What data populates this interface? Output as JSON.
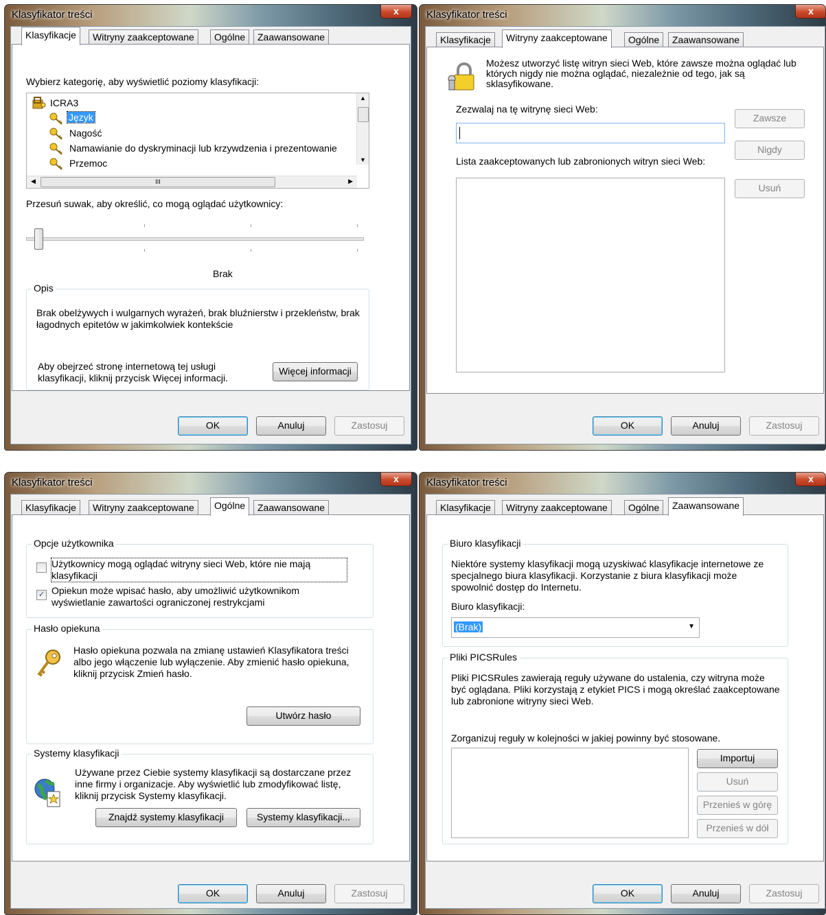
{
  "common": {
    "title": "Klasyfikator treści",
    "close": "x",
    "tabs": [
      "Klasyfikacje",
      "Witryny zaakceptowane",
      "Ogólne",
      "Zaawansowane"
    ],
    "ok": "OK",
    "cancel": "Anuluj",
    "apply": "Zastosuj"
  },
  "ratings": {
    "choose_label": "Wybierz kategorię, aby wyświetlić poziomy klasyfikacji:",
    "tree": {
      "root": "ICRA3",
      "items": [
        "Język",
        "Nagość",
        "Namawianie do dyskryminacji lub krzywdzenia i prezentowanie",
        "Przemoc"
      ],
      "scroll_grip": "III"
    },
    "slider_label": "Przesuń suwak, aby określić, co mogą oglądać użytkownicy:",
    "level": "Brak",
    "description_group": "Opis",
    "description": "Brak obelżywych i wulgarnych wyrażeń, brak bluźnierstw i przekleństw, brak łagodnych epitetów w jakimkolwiek kontekście",
    "more_info_text": "Aby obejrzeć stronę internetową tej usługi klasyfikacji, kliknij przycisk Więcej informacji.",
    "more_info_button": "Więcej informacji"
  },
  "approved": {
    "intro": "Możesz utworzyć listę witryn sieci Web, które zawsze można oglądać lub których nigdy nie można oglądać, niezależnie od tego, jak są sklasyfikowane.",
    "allow_label": "Zezwalaj na tę witrynę sieci Web:",
    "site_value": "",
    "always_button": "Zawsze",
    "never_button": "Nigdy",
    "list_label": "Lista zaakceptowanych lub zabronionych witryn sieci Web:",
    "remove_button": "Usuń"
  },
  "general": {
    "user_options_group": "Opcje użytkownika",
    "option1": "Użytkownicy mogą oglądać witryny sieci Web, które nie mają klasyfikacji",
    "option1_checked": false,
    "option2": "Opiekun może wpisać hasło, aby umożliwić użytkownikom wyświetlanie zawartości ograniczonej restrykcjami",
    "option2_checked": true,
    "password_group": "Hasło opiekuna",
    "password_text": "Hasło opiekuna pozwala na zmianę ustawień Klasyfikatora treści albo jego włączenie lub wyłączenie. Aby zmienić hasło opiekuna, kliknij przycisk Zmień hasło.",
    "create_password_button": "Utwórz hasło",
    "systems_group": "Systemy klasyfikacji",
    "systems_text": "Używane przez Ciebie systemy klasyfikacji są dostarczane przez inne firmy i organizacje. Aby wyświetlić lub zmodyfikować listę, kliknij przycisk Systemy klasyfikacji.",
    "find_systems_button": "Znajdź systemy klasyfikacji",
    "systems_button": "Systemy klasyfikacji..."
  },
  "advanced": {
    "bureau_group": "Biuro klasyfikacji",
    "bureau_text": "Niektóre systemy klasyfikacji mogą uzyskiwać klasyfikacje internetowe ze specjalnego biura klasyfikacji. Korzystanie z biura klasyfikacji może spowolnić dostęp do Internetu.",
    "bureau_label": "Biuro klasyfikacji:",
    "bureau_value": "(Brak)",
    "pics_group": "Pliki PICSRules",
    "pics_text": "Pliki PICSRules zawierają reguły używane do ustalenia, czy witryna może być oglądana. Pliki korzystają z etykiet PICS i mogą określać zaakceptowane lub zabronione witryny sieci Web.",
    "order_label": "Zorganizuj reguły w kolejności w jakiej powinny być stosowane.",
    "import_button": "Importuj",
    "remove_button": "Usuń",
    "move_up_button": "Przenieś w górę",
    "move_down_button": "Przenieś w dół"
  }
}
